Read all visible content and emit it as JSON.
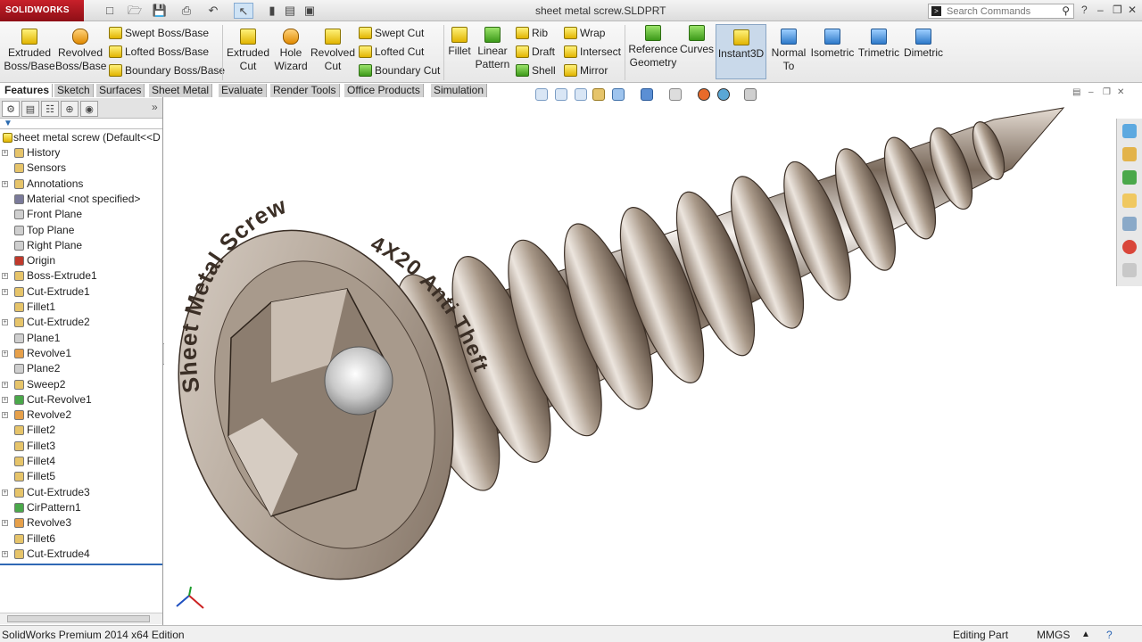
{
  "title_bar": {
    "app_logo": "SOLIDWORKS",
    "document_title": "sheet metal screw.SLDPRT",
    "search_placeholder": "Search Commands",
    "help_label": "?"
  },
  "ribbon": {
    "extruded_boss": "Extruded Boss/Base",
    "revolved_boss": "Revolved Boss/Base",
    "swept_boss": "Swept Boss/Base",
    "lofted_boss": "Lofted Boss/Base",
    "boundary_boss": "Boundary Boss/Base",
    "extruded_cut": "Extruded Cut",
    "hole_wizard": "Hole Wizard",
    "revolved_cut": "Revolved Cut",
    "swept_cut": "Swept Cut",
    "lofted_cut": "Lofted Cut",
    "boundary_cut": "Boundary Cut",
    "fillet": "Fillet",
    "linear_pattern": "Linear Pattern",
    "rib": "Rib",
    "draft": "Draft",
    "shell": "Shell",
    "wrap": "Wrap",
    "intersect": "Intersect",
    "mirror": "Mirror",
    "reference_geometry": "Reference Geometry",
    "curves": "Curves",
    "instant3d": "Instant3D",
    "normal_to": "Normal To",
    "isometric": "Isometric",
    "trimetric": "Trimetric",
    "dimetric": "Dimetric"
  },
  "tabs": [
    "Features",
    "Sketch",
    "Surfaces",
    "Sheet Metal",
    "Evaluate",
    "Render Tools",
    "Office Products",
    "Simulation"
  ],
  "feature_tree": {
    "root": "sheet metal screw  (Default<<D",
    "items": [
      {
        "label": "History",
        "icon": "history-icon",
        "expandable": true
      },
      {
        "label": "Sensors",
        "icon": "sensors-icon",
        "expandable": false
      },
      {
        "label": "Annotations",
        "icon": "annotations-icon",
        "expandable": true
      },
      {
        "label": "Material <not specified>",
        "icon": "material-icon",
        "expandable": false
      },
      {
        "label": "Front Plane",
        "icon": "plane-icon",
        "expandable": false
      },
      {
        "label": "Top Plane",
        "icon": "plane-icon",
        "expandable": false
      },
      {
        "label": "Right Plane",
        "icon": "plane-icon",
        "expandable": false
      },
      {
        "label": "Origin",
        "icon": "origin-icon",
        "expandable": false
      },
      {
        "label": "Boss-Extrude1",
        "icon": "extrude-icon",
        "expandable": true
      },
      {
        "label": "Cut-Extrude1",
        "icon": "cut-extrude-icon",
        "expandable": true
      },
      {
        "label": "Fillet1",
        "icon": "fillet-icon",
        "expandable": false
      },
      {
        "label": "Cut-Extrude2",
        "icon": "cut-extrude-icon",
        "expandable": true
      },
      {
        "label": "Plane1",
        "icon": "plane-icon",
        "expandable": false
      },
      {
        "label": "Revolve1",
        "icon": "revolve-icon",
        "expandable": true
      },
      {
        "label": "Plane2",
        "icon": "plane-icon",
        "expandable": false
      },
      {
        "label": "Sweep2",
        "icon": "sweep-icon",
        "expandable": true
      },
      {
        "label": "Cut-Revolve1",
        "icon": "cut-revolve-icon",
        "expandable": true
      },
      {
        "label": "Revolve2",
        "icon": "revolve-icon",
        "expandable": true
      },
      {
        "label": "Fillet2",
        "icon": "fillet-icon",
        "expandable": false
      },
      {
        "label": "Fillet3",
        "icon": "fillet-icon",
        "expandable": false
      },
      {
        "label": "Fillet4",
        "icon": "fillet-icon",
        "expandable": false
      },
      {
        "label": "Fillet5",
        "icon": "fillet-icon",
        "expandable": false
      },
      {
        "label": "Cut-Extrude3",
        "icon": "cut-extrude-icon",
        "expandable": true
      },
      {
        "label": "CirPattern1",
        "icon": "pattern-icon",
        "expandable": false
      },
      {
        "label": "Revolve3",
        "icon": "revolve-icon",
        "expandable": true
      },
      {
        "label": "Fillet6",
        "icon": "fillet-icon",
        "expandable": false
      },
      {
        "label": "Cut-Extrude4",
        "icon": "cut-extrude-icon",
        "expandable": true
      }
    ]
  },
  "model": {
    "engraving_top": "Sheet Metal Screw",
    "engraving_side": "4X20 Anti Theft"
  },
  "status_bar": {
    "edition": "SolidWorks Premium 2014 x64 Edition",
    "mode": "Editing Part",
    "units": "MMGS"
  },
  "colors": {
    "accent_blue": "#2f68b5",
    "instant3d_active": "#c9d9ea",
    "logo_red": "#c8202a"
  }
}
